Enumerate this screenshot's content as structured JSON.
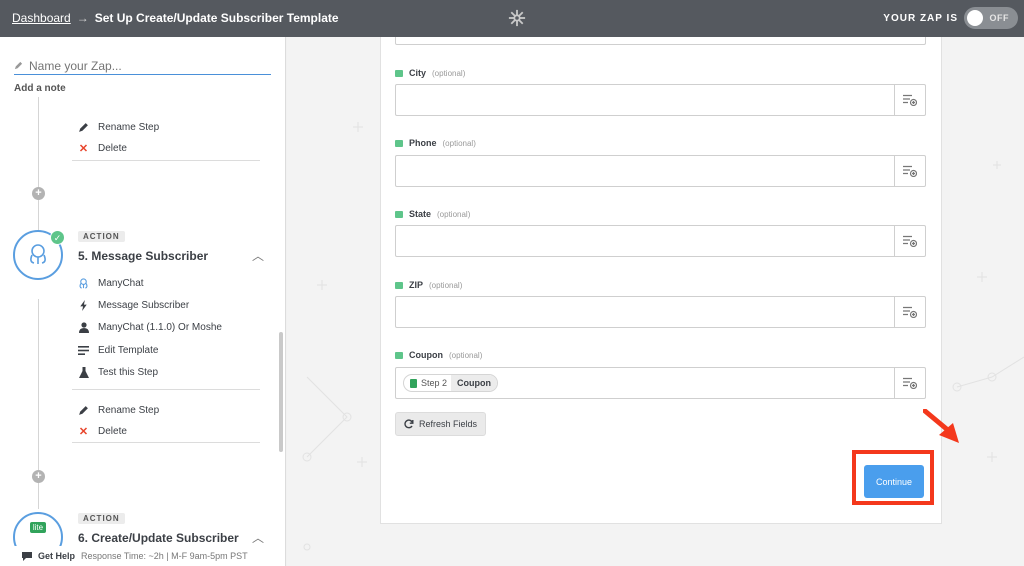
{
  "topbar": {
    "breadcrumb_link": "Dashboard",
    "breadcrumb_arrow": "→",
    "page_title": "Set Up Create/Update Subscriber Template",
    "zap_is_label": "YOUR ZAP IS",
    "toggle_state": "OFF"
  },
  "sidebar": {
    "zap_name_placeholder": "Name your Zap...",
    "add_note": "Add a note",
    "step4_menu": [
      {
        "label": "Rename Step",
        "icon": "pencil-icon"
      },
      {
        "label": "Delete",
        "icon": "close-x-icon"
      }
    ],
    "step5": {
      "tag": "ACTION",
      "title": "5. Message Subscriber",
      "items": [
        {
          "label": "ManyChat",
          "icon": "manychat-icon"
        },
        {
          "label": "Message Subscriber",
          "icon": "bolt-icon"
        },
        {
          "label": "ManyChat (1.1.0) Or Moshe",
          "icon": "user-icon"
        },
        {
          "label": "Edit Template",
          "icon": "lines-icon"
        },
        {
          "label": "Test this Step",
          "icon": "flask-icon"
        }
      ],
      "menu": [
        {
          "label": "Rename Step",
          "icon": "pencil-icon"
        },
        {
          "label": "Delete",
          "icon": "close-x-icon"
        }
      ]
    },
    "step6": {
      "tag": "ACTION",
      "title": "6. Create/Update Subscriber",
      "icon_text": "lite"
    },
    "get_help": "Get Help",
    "response_time": "Response Time: ~2h | M-F 9am-5pm PST"
  },
  "form": {
    "optional_label": "(optional)",
    "fields": [
      {
        "label": "City",
        "value": ""
      },
      {
        "label": "Phone",
        "value": ""
      },
      {
        "label": "State",
        "value": ""
      },
      {
        "label": "ZIP",
        "value": ""
      },
      {
        "label": "Coupon",
        "pill_step": "Step 2",
        "pill_value": "Coupon"
      }
    ],
    "refresh_label": "Refresh Fields",
    "continue_label": "Continue"
  },
  "colors": {
    "accent": "#4a9eed",
    "highlight": "#f4381c",
    "topbar": "#55595f",
    "success": "#5ec58a"
  }
}
